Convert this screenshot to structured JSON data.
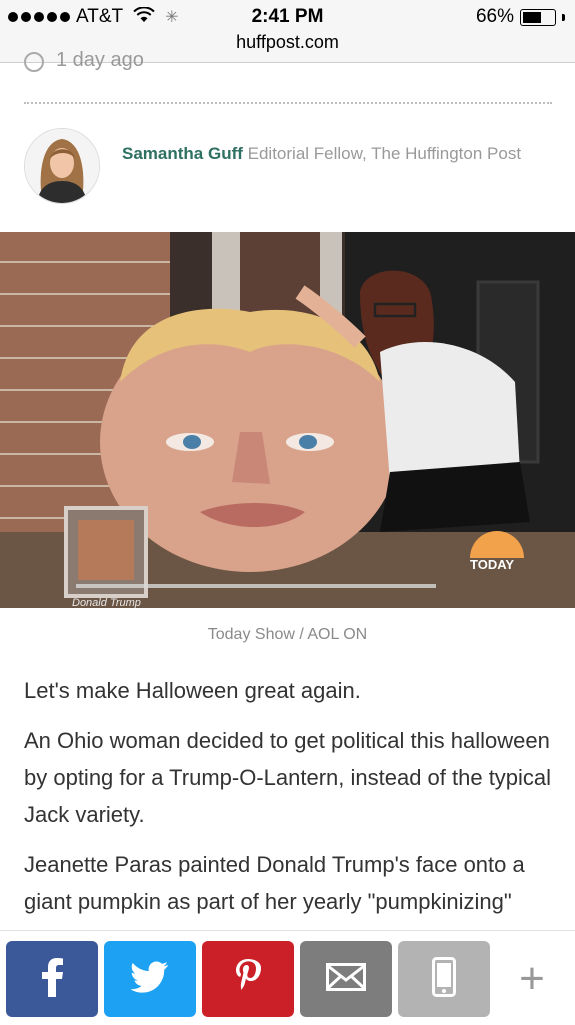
{
  "status_bar": {
    "carrier": "AT&T",
    "time": "2:41 PM",
    "battery": "66%",
    "battery_level": 0.66,
    "url": "huffpost.com"
  },
  "article": {
    "timestamp": "1 day ago",
    "author": {
      "name": "Samantha Guff",
      "role": "Editorial Fellow, The Huffington Post"
    },
    "video": {
      "tv_logo": "TODAY",
      "frame_label": "Donald Trump"
    },
    "media_caption": "Today Show / AOL ON",
    "paragraphs": [
      "Let's make Halloween great again.",
      "An Ohio woman decided to get political this halloween by opting for a Trump-O-Lantern, instead of the typical Jack variety.",
      "Jeanette Paras painted Donald Trump's face onto a giant pumpkin as part of her yearly \"pumpkinizing\" process, which consists of taking"
    ]
  },
  "share_bar": {
    "buttons": [
      {
        "name": "facebook",
        "icon": "facebook-icon",
        "color": "#3b5998"
      },
      {
        "name": "twitter",
        "icon": "twitter-icon",
        "color": "#1da1f2"
      },
      {
        "name": "pinterest",
        "icon": "pinterest-icon",
        "color": "#cb2027"
      },
      {
        "name": "email",
        "icon": "envelope-icon",
        "color": "#7d7d7d"
      },
      {
        "name": "sms",
        "icon": "phone-icon",
        "color": "#b3b3b3"
      },
      {
        "name": "more",
        "icon": "plus-icon",
        "color": "#999999"
      }
    ]
  }
}
